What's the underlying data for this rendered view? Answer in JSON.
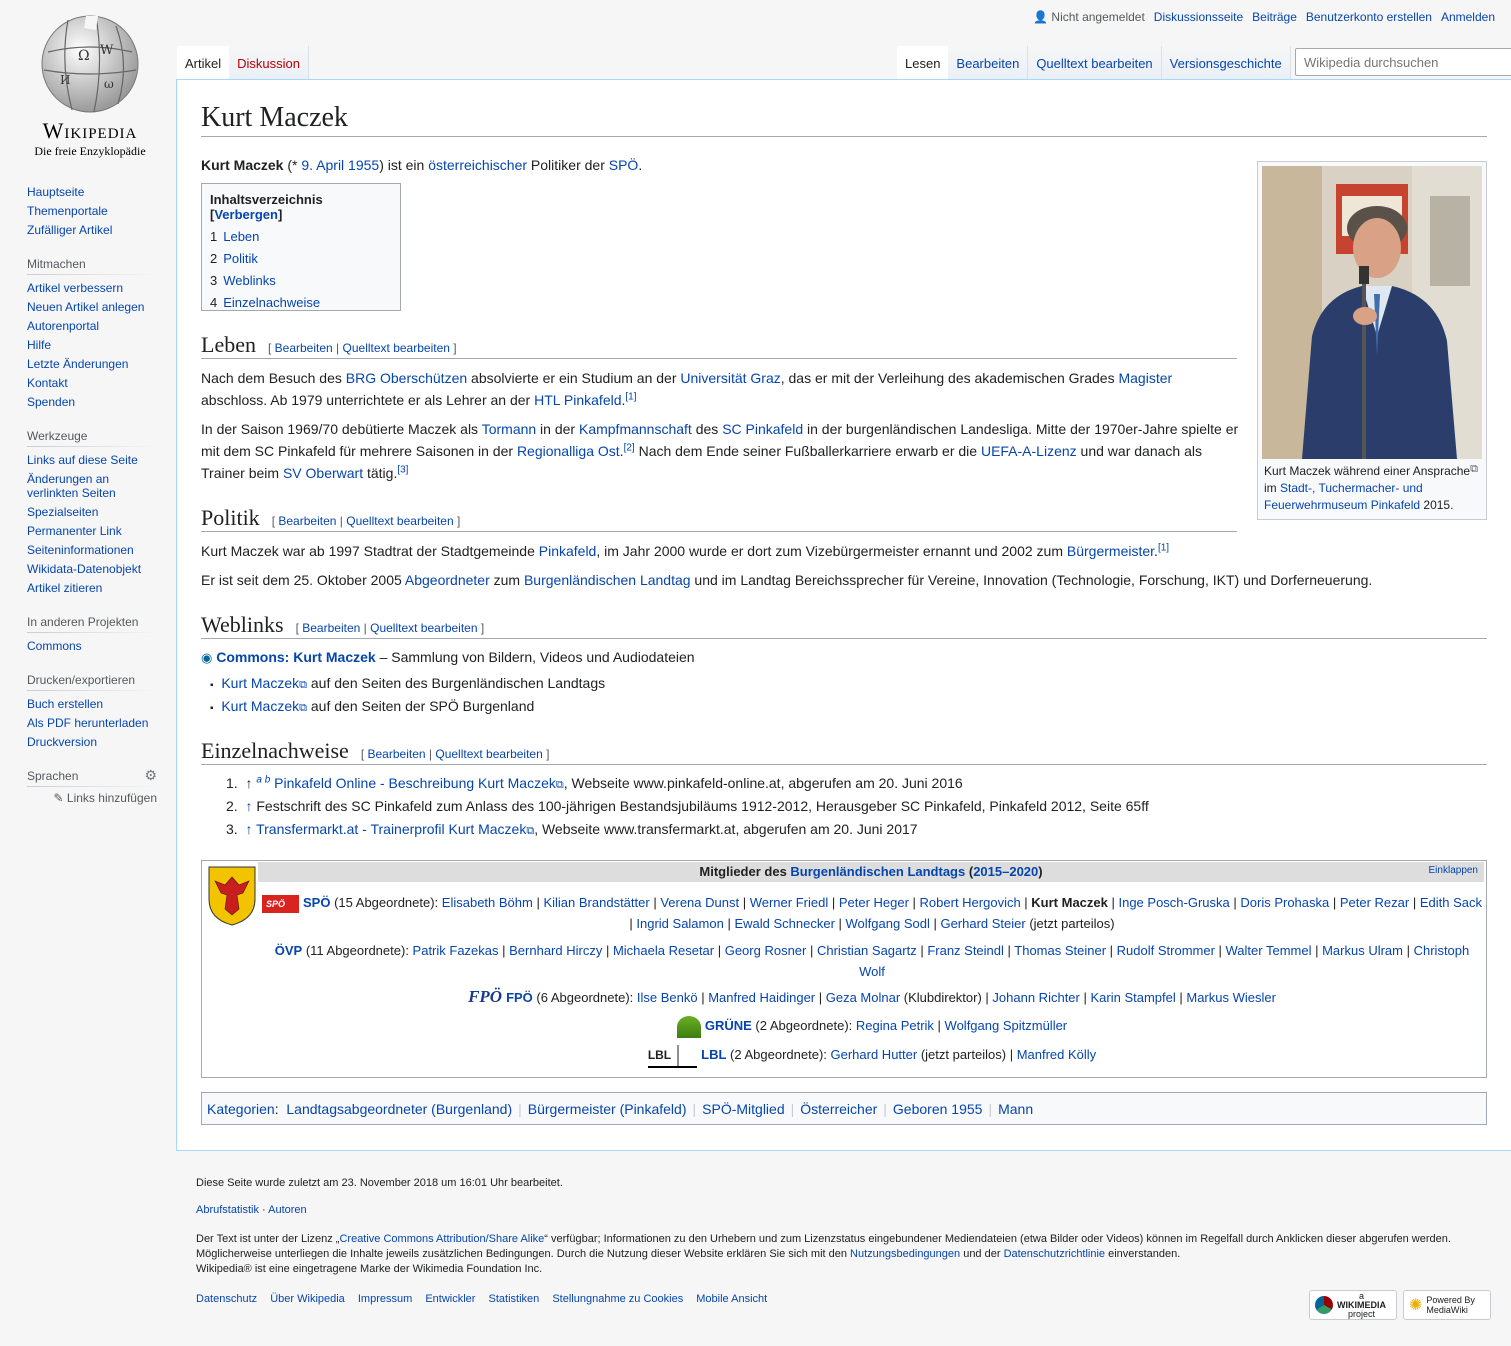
{
  "logo": {
    "wordmark": "Wikipedia",
    "tagline": "Die freie Enzyklopädie"
  },
  "personal_tools": {
    "not_logged_in": "Nicht angemeldet",
    "items": [
      "Diskussionsseite",
      "Beiträge",
      "Benutzerkonto erstellen",
      "Anmelden"
    ]
  },
  "tabs": {
    "left": [
      "Artikel",
      "Diskussion"
    ],
    "right": [
      "Lesen",
      "Bearbeiten",
      "Quelltext bearbeiten",
      "Versionsgeschichte"
    ]
  },
  "search": {
    "placeholder": "Wikipedia durchsuchen"
  },
  "sidebar": {
    "nav": [
      "Hauptseite",
      "Themenportale",
      "Zufälliger Artikel"
    ],
    "mitmachen": {
      "title": "Mitmachen",
      "items": [
        "Artikel verbessern",
        "Neuen Artikel anlegen",
        "Autorenportal",
        "Hilfe",
        "Letzte Änderungen",
        "Kontakt",
        "Spenden"
      ]
    },
    "werkzeuge": {
      "title": "Werkzeuge",
      "items": [
        "Links auf diese Seite",
        "Änderungen an verlinkten Seiten",
        "Spezialseiten",
        "Permanenter Link",
        "Seiteninformationen",
        "Wikidata-Datenobjekt",
        "Artikel zitieren"
      ]
    },
    "projekte": {
      "title": "In anderen Projekten",
      "items": [
        "Commons"
      ]
    },
    "drucken": {
      "title": "Drucken/exportieren",
      "items": [
        "Buch erstellen",
        "Als PDF herunterladen",
        "Druckversion"
      ]
    },
    "sprachen": {
      "title": "Sprachen",
      "add_links": "Links hinzufügen"
    }
  },
  "article": {
    "title": "Kurt Maczek",
    "intro": {
      "name": "Kurt Maczek",
      "p1": " (* ",
      "date": "9. April 1955",
      "p2": ") ist ein ",
      "nationality": "österreichischer",
      "p3": " Politiker der ",
      "party": "SPÖ",
      "p4": "."
    },
    "edit": {
      "open": "[",
      "edit": "Bearbeiten",
      "sep": "|",
      "source": "Quelltext bearbeiten",
      "close": "]"
    },
    "toc": {
      "title": "Inhaltsverzeichnis",
      "hide": "Verbergen",
      "items": [
        {
          "num": "1",
          "label": "Leben"
        },
        {
          "num": "2",
          "label": "Politik"
        },
        {
          "num": "3",
          "label": "Weblinks"
        },
        {
          "num": "4",
          "label": "Einzelnachweise"
        }
      ]
    },
    "leben": {
      "heading": "Leben",
      "p1": [
        "Nach dem Besuch des ",
        "BRG Oberschützen",
        " absolvierte er ein Studium an der ",
        "Universität Graz",
        ", das er mit der Verleihung des akademischen Grades ",
        "Magister",
        " abschloss. Ab 1979 unterrichtete er als Lehrer an der ",
        "HTL Pinkafeld",
        ".",
        "[1]"
      ],
      "p2": [
        "In der Saison 1969/70 debütierte Maczek als ",
        "Tormann",
        " in der ",
        "Kampfmannschaft",
        " des ",
        "SC Pinkafeld",
        " in der burgenländischen Landesliga. Mitte der 1970er-Jahre spielte er mit dem SC Pinkafeld für mehrere Saisonen in der ",
        "Regionalliga Ost",
        ".",
        "[2]",
        " Nach dem Ende seiner Fußballerkarriere erwarb er die ",
        "UEFA-A-Lizenz",
        " und war danach als Trainer beim ",
        "SV Oberwart",
        " tätig.",
        "[3]"
      ]
    },
    "politik": {
      "heading": "Politik",
      "p1": [
        "Kurt Maczek war ab 1997 Stadtrat der Stadtgemeinde ",
        "Pinkafeld",
        ", im Jahr 2000 wurde er dort zum Vizebürgermeister ernannt und 2002 zum ",
        "Bürgermeister",
        ".",
        "[1]"
      ],
      "p2": [
        "Er ist seit dem 25. Oktober 2005 ",
        "Abgeordneter",
        " zum ",
        "Burgenländischen Landtag",
        " und im Landtag Bereichssprecher für Vereine, Innovation (Technologie, Forschung, IKT) und Dorferneuerung."
      ]
    },
    "weblinks": {
      "heading": "Weblinks",
      "commons_link": "Commons: Kurt Maczek",
      "commons_text": " – Sammlung von Bildern, Videos und Audiodateien",
      "items": [
        {
          "link": "Kurt Maczek",
          "text": " auf den Seiten des Burgenländischen Landtags"
        },
        {
          "link": "Kurt Maczek",
          "text": " auf den Seiten der SPÖ Burgenland"
        }
      ]
    },
    "refs": {
      "heading": "Einzelnachweise",
      "items": [
        {
          "num": "1.",
          "arrow": "↑",
          "letters": "a b",
          "link": "Pinkafeld Online - Beschreibung Kurt Maczek",
          "text": ", Webseite www.pinkafeld-online.at, abgerufen am 20. Juni 2016"
        },
        {
          "num": "2.",
          "arrow": "↑",
          "letters": "",
          "link": "",
          "text": "Festschrift des SC Pinkafeld zum Anlass des 100-jährigen Bestandsjubiläums 1912-2012, Herausgeber SC Pinkafeld, Pinkafeld 2012, Seite 65ff"
        },
        {
          "num": "3.",
          "arrow": "↑",
          "letters": "",
          "link": "Transfermarkt.at - Trainerprofil Kurt Maczek",
          "text": ", Webseite www.transfermarkt.at, abgerufen am 20. Juni 2017"
        }
      ]
    },
    "thumb": {
      "caption_pre": "Kurt Maczek während einer Ansprache im ",
      "caption_link": "Stadt-, Tuchermacher- und Feuerwehrmuseum Pinkafeld",
      "caption_post": " 2015."
    }
  },
  "navbox": {
    "title_pre": "Mitglieder des ",
    "title_link": "Burgenländischen Landtags",
    "title_open": " (",
    "title_years": "2015–2020",
    "title_close": ")",
    "toggle": "Einklappen",
    "spoe": {
      "party": "SPÖ",
      "count": " (15 Abgeordnete): ",
      "logo": "SPÖ"
    },
    "spoe_members": [
      "Elisabeth Böhm",
      "Kilian Brandstätter",
      "Verena Dunst",
      "Werner Friedl",
      "Peter Heger",
      "Robert Hergovich",
      "Kurt Maczek",
      "Inge Posch-Gruska",
      "Doris Prohaska",
      "Peter Rezar",
      "Edith Sack",
      "Ingrid Salamon",
      "Ewald Schnecker",
      "Wolfgang Sodl",
      "Gerhard Steier"
    ],
    "spoe_note": " (jetzt parteilos)",
    "oevp": {
      "party": "ÖVP",
      "count": " (11 Abgeordnete): "
    },
    "oevp_members": [
      "Patrik Fazekas",
      "Bernhard Hirczy",
      "Michaela Resetar",
      "Georg Rosner",
      "Christian Sagartz",
      "Franz Steindl",
      "Thomas Steiner",
      "Rudolf Strommer",
      "Walter Temmel",
      "Markus Ulram",
      "Christoph Wolf"
    ],
    "fpoe": {
      "party": "FPÖ",
      "count": " (6 Abgeordnete): ",
      "logo": "FPÖ"
    },
    "fpoe_members": [
      "Ilse Benkö",
      "Manfred Haidinger",
      "Geza Molnar",
      "Johann Richter",
      "Karin Stampfel",
      "Markus Wiesler"
    ],
    "fpoe_note": " (Klubdirektor)",
    "gruene": {
      "party": "GRÜNE",
      "count": " (2 Abgeordnete): "
    },
    "gruene_members": [
      "Regina Petrik",
      "Wolfgang Spitzmüller"
    ],
    "lbl": {
      "party": "LBL",
      "count": " (2 Abgeordnete): ",
      "logo": "LBL"
    },
    "lbl_members": [
      "Gerhard Hutter",
      "Manfred Kölly"
    ],
    "lbl_note": " (jetzt parteilos)"
  },
  "categories": {
    "label": "Kategorien",
    "colon": ":",
    "items": [
      "Landtagsabgeordneter (Burgenland)",
      "Bürgermeister (Pinkafeld)",
      "SPÖ-Mitglied",
      "Österreicher",
      "Geboren 1955",
      "Mann"
    ]
  },
  "footer": {
    "lastmod": "Diese Seite wurde zuletzt am 23. November 2018 um 16:01 Uhr bearbeitet.",
    "stats": "Abrufstatistik",
    "dot": " · ",
    "authors": "Autoren",
    "lic1": "Der Text ist unter der Lizenz „",
    "lic_link": "Creative Commons Attribution/Share Alike",
    "lic2": "“ verfügbar; Informationen zu den Urhebern und zum Lizenzstatus eingebundener Mediendateien (etwa Bilder oder Videos) können im Regelfall durch Anklicken dieser abgerufen werden.",
    "lic3": "Möglicherweise unterliegen die Inhalte jeweils zusätzlichen Bedingungen. Durch die Nutzung dieser Website erklären Sie sich mit den ",
    "terms": "Nutzungsbedingungen",
    "and": " und der ",
    "privacy": "Datenschutzrichtlinie",
    "agree": " einverstanden.",
    "trademark": "Wikipedia® ist eine eingetragene Marke der Wikimedia Foundation Inc.",
    "links": [
      "Datenschutz",
      "Über Wikipedia",
      "Impressum",
      "Entwickler",
      "Statistiken",
      "Stellungnahme zu Cookies",
      "Mobile Ansicht"
    ],
    "badge_wm_small": "a",
    "badge_wm": "WIKIMEDIA",
    "badge_wm_sub": "project",
    "badge_mw1": "Powered By",
    "badge_mw2": "MediaWiki"
  }
}
